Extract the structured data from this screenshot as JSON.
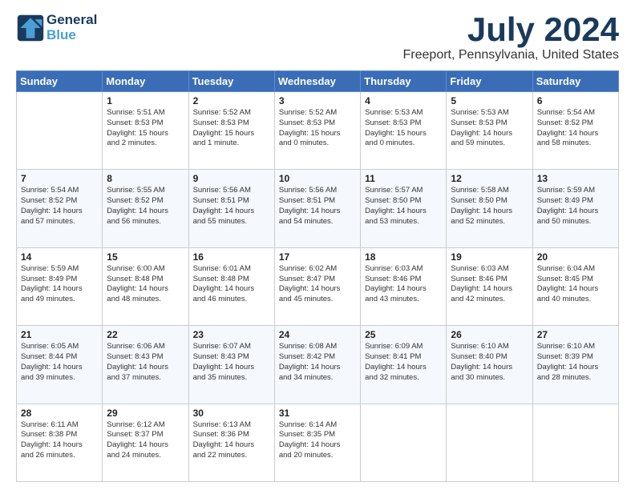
{
  "header": {
    "logo_line1": "General",
    "logo_line2": "Blue",
    "title": "July 2024",
    "location": "Freeport, Pennsylvania, United States"
  },
  "days_of_week": [
    "Sunday",
    "Monday",
    "Tuesday",
    "Wednesday",
    "Thursday",
    "Friday",
    "Saturday"
  ],
  "weeks": [
    [
      {
        "day": "",
        "info": ""
      },
      {
        "day": "1",
        "info": "Sunrise: 5:51 AM\nSunset: 8:53 PM\nDaylight: 15 hours\nand 2 minutes."
      },
      {
        "day": "2",
        "info": "Sunrise: 5:52 AM\nSunset: 8:53 PM\nDaylight: 15 hours\nand 1 minute."
      },
      {
        "day": "3",
        "info": "Sunrise: 5:52 AM\nSunset: 8:53 PM\nDaylight: 15 hours\nand 0 minutes."
      },
      {
        "day": "4",
        "info": "Sunrise: 5:53 AM\nSunset: 8:53 PM\nDaylight: 15 hours\nand 0 minutes."
      },
      {
        "day": "5",
        "info": "Sunrise: 5:53 AM\nSunset: 8:53 PM\nDaylight: 14 hours\nand 59 minutes."
      },
      {
        "day": "6",
        "info": "Sunrise: 5:54 AM\nSunset: 8:52 PM\nDaylight: 14 hours\nand 58 minutes."
      }
    ],
    [
      {
        "day": "7",
        "info": "Sunrise: 5:54 AM\nSunset: 8:52 PM\nDaylight: 14 hours\nand 57 minutes."
      },
      {
        "day": "8",
        "info": "Sunrise: 5:55 AM\nSunset: 8:52 PM\nDaylight: 14 hours\nand 56 minutes."
      },
      {
        "day": "9",
        "info": "Sunrise: 5:56 AM\nSunset: 8:51 PM\nDaylight: 14 hours\nand 55 minutes."
      },
      {
        "day": "10",
        "info": "Sunrise: 5:56 AM\nSunset: 8:51 PM\nDaylight: 14 hours\nand 54 minutes."
      },
      {
        "day": "11",
        "info": "Sunrise: 5:57 AM\nSunset: 8:50 PM\nDaylight: 14 hours\nand 53 minutes."
      },
      {
        "day": "12",
        "info": "Sunrise: 5:58 AM\nSunset: 8:50 PM\nDaylight: 14 hours\nand 52 minutes."
      },
      {
        "day": "13",
        "info": "Sunrise: 5:59 AM\nSunset: 8:49 PM\nDaylight: 14 hours\nand 50 minutes."
      }
    ],
    [
      {
        "day": "14",
        "info": "Sunrise: 5:59 AM\nSunset: 8:49 PM\nDaylight: 14 hours\nand 49 minutes."
      },
      {
        "day": "15",
        "info": "Sunrise: 6:00 AM\nSunset: 8:48 PM\nDaylight: 14 hours\nand 48 minutes."
      },
      {
        "day": "16",
        "info": "Sunrise: 6:01 AM\nSunset: 8:48 PM\nDaylight: 14 hours\nand 46 minutes."
      },
      {
        "day": "17",
        "info": "Sunrise: 6:02 AM\nSunset: 8:47 PM\nDaylight: 14 hours\nand 45 minutes."
      },
      {
        "day": "18",
        "info": "Sunrise: 6:03 AM\nSunset: 8:46 PM\nDaylight: 14 hours\nand 43 minutes."
      },
      {
        "day": "19",
        "info": "Sunrise: 6:03 AM\nSunset: 8:46 PM\nDaylight: 14 hours\nand 42 minutes."
      },
      {
        "day": "20",
        "info": "Sunrise: 6:04 AM\nSunset: 8:45 PM\nDaylight: 14 hours\nand 40 minutes."
      }
    ],
    [
      {
        "day": "21",
        "info": "Sunrise: 6:05 AM\nSunset: 8:44 PM\nDaylight: 14 hours\nand 39 minutes."
      },
      {
        "day": "22",
        "info": "Sunrise: 6:06 AM\nSunset: 8:43 PM\nDaylight: 14 hours\nand 37 minutes."
      },
      {
        "day": "23",
        "info": "Sunrise: 6:07 AM\nSunset: 8:43 PM\nDaylight: 14 hours\nand 35 minutes."
      },
      {
        "day": "24",
        "info": "Sunrise: 6:08 AM\nSunset: 8:42 PM\nDaylight: 14 hours\nand 34 minutes."
      },
      {
        "day": "25",
        "info": "Sunrise: 6:09 AM\nSunset: 8:41 PM\nDaylight: 14 hours\nand 32 minutes."
      },
      {
        "day": "26",
        "info": "Sunrise: 6:10 AM\nSunset: 8:40 PM\nDaylight: 14 hours\nand 30 minutes."
      },
      {
        "day": "27",
        "info": "Sunrise: 6:10 AM\nSunset: 8:39 PM\nDaylight: 14 hours\nand 28 minutes."
      }
    ],
    [
      {
        "day": "28",
        "info": "Sunrise: 6:11 AM\nSunset: 8:38 PM\nDaylight: 14 hours\nand 26 minutes."
      },
      {
        "day": "29",
        "info": "Sunrise: 6:12 AM\nSunset: 8:37 PM\nDaylight: 14 hours\nand 24 minutes."
      },
      {
        "day": "30",
        "info": "Sunrise: 6:13 AM\nSunset: 8:36 PM\nDaylight: 14 hours\nand 22 minutes."
      },
      {
        "day": "31",
        "info": "Sunrise: 6:14 AM\nSunset: 8:35 PM\nDaylight: 14 hours\nand 20 minutes."
      },
      {
        "day": "",
        "info": ""
      },
      {
        "day": "",
        "info": ""
      },
      {
        "day": "",
        "info": ""
      }
    ]
  ]
}
